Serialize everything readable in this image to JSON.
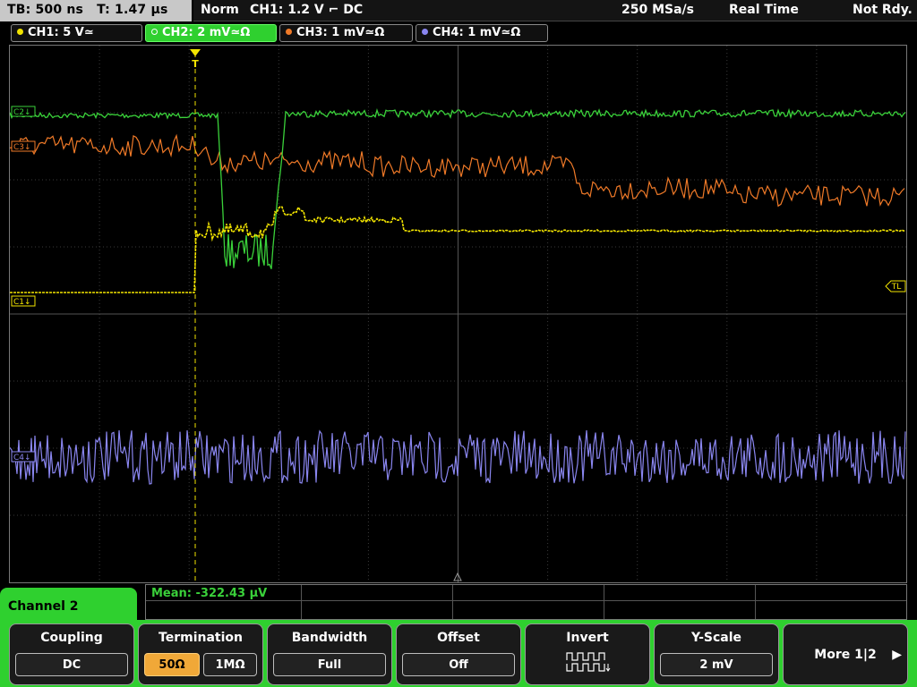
{
  "status": {
    "tb": "TB: 500 ns",
    "t": "T: 1.47 µs",
    "mode": "Norm",
    "trigger": "CH1: 1.2 V ⌐ DC",
    "sample_rate": "250 MSa/s",
    "acq": "Real Time",
    "ready": "Not Rdy."
  },
  "channels": [
    {
      "label": "CH1: 5 V≃",
      "color": "#f2e400"
    },
    {
      "label": "CH2: 2 mV≃Ω",
      "color": "#3ad13a"
    },
    {
      "label": "CH3: 1 mV≃Ω",
      "color": "#f07a28"
    },
    {
      "label": "CH4: 1 mV≃Ω",
      "color": "#8a86f0"
    }
  ],
  "markers": {
    "c1": "C1↓",
    "c2": "C2↓",
    "c3": "C3↓",
    "c4": "C4↓",
    "trigger_level": "TL",
    "trigger_pos": "T"
  },
  "measurement": {
    "mean": "Mean: -322.43 µV"
  },
  "menu": {
    "title": "Channel 2",
    "keys": {
      "coupling": {
        "label": "Coupling",
        "value": "DC"
      },
      "termination": {
        "label": "Termination",
        "value_a": "50Ω",
        "value_b": "1MΩ"
      },
      "bandwidth": {
        "label": "Bandwidth",
        "value": "Full"
      },
      "offset": {
        "label": "Offset",
        "value": "Off"
      },
      "invert": {
        "label": "Invert"
      },
      "yscale": {
        "label": "Y-Scale",
        "value": "2 mV"
      },
      "more": {
        "label": "More 1|2"
      }
    }
  },
  "colors": {
    "ch1": "#f2e400",
    "ch2": "#3ad13a",
    "ch3": "#f07a28",
    "ch4": "#8a86f0",
    "softkey_bg": "#2fd02f",
    "selected": "#f0a838"
  }
}
